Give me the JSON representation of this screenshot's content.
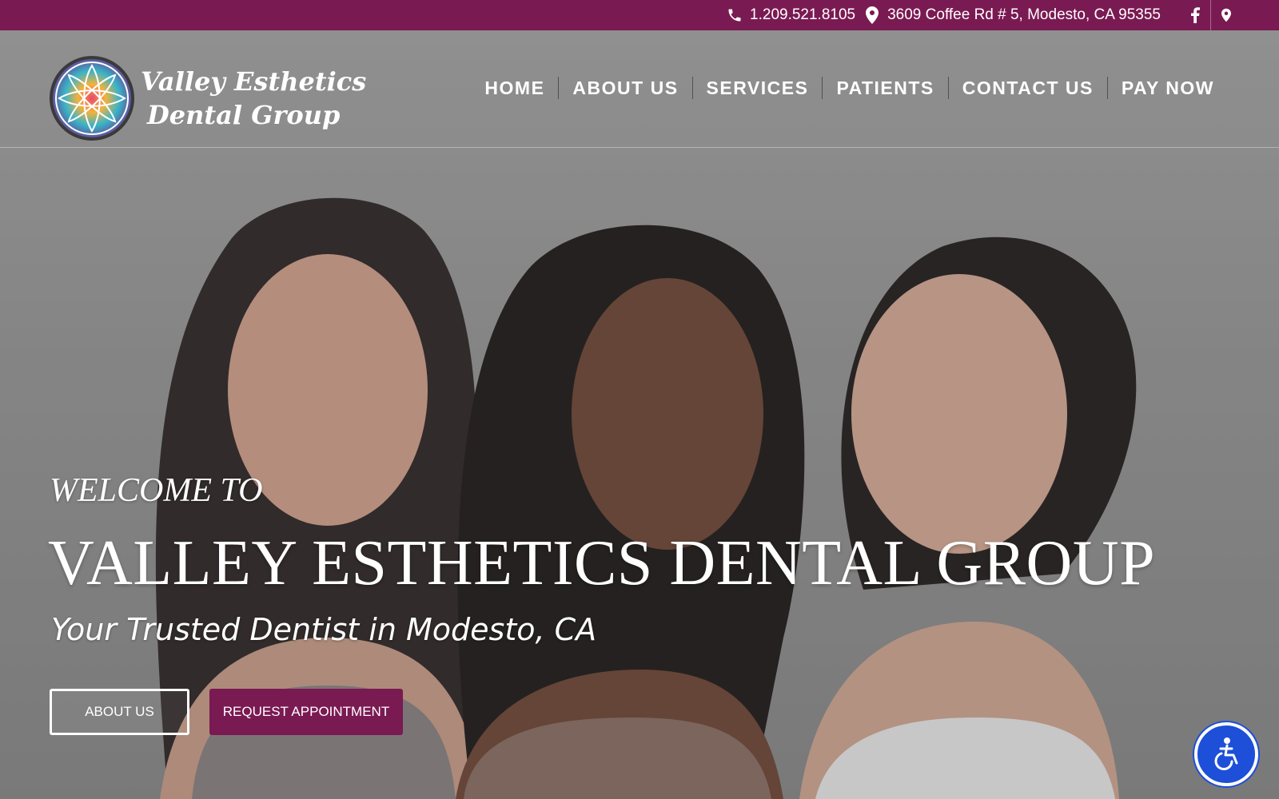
{
  "topbar": {
    "phone": "1.209.521.8105",
    "address": "3609 Coffee Rd # 5, Modesto, CA 95355",
    "icons": [
      "phone-icon",
      "map-marker-icon",
      "facebook-icon",
      "map-pin-icon"
    ]
  },
  "logo": {
    "line1": "Valley Esthetics",
    "line2": "Dental Group"
  },
  "nav": {
    "items": [
      "HOME",
      "ABOUT US",
      "SERVICES",
      "PATIENTS",
      "CONTACT US",
      "PAY NOW"
    ]
  },
  "hero": {
    "welcome": "WELCOME TO",
    "headline": "VALLEY ESTHETICS DENTAL GROUP",
    "tagline": "Your Trusted Dentist in Modesto, CA",
    "buttons": {
      "about": "ABOUT US",
      "request": "REQUEST APPOINTMENT"
    }
  },
  "accessibility": {
    "icon": "accessibility-icon"
  },
  "colors": {
    "brand": "#7a1a52",
    "accessibility": "#1d4fd8"
  }
}
